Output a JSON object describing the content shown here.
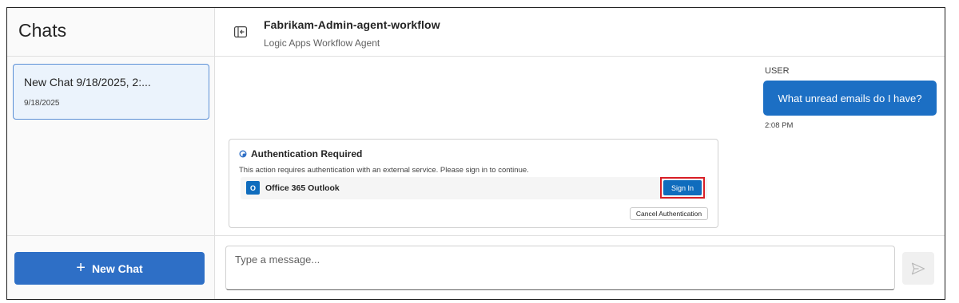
{
  "sidebar": {
    "title": "Chats",
    "chats": [
      {
        "title": "New Chat 9/18/2025, 2:...",
        "date": "9/18/2025"
      }
    ],
    "new_chat_label": "New Chat"
  },
  "header": {
    "title": "Fabrikam-Admin-agent-workflow",
    "subtitle": "Logic Apps Workflow Agent"
  },
  "conversation": {
    "user_label": "USER",
    "user_message": "What unread emails do I have?",
    "time": "2:08 PM",
    "auth_card": {
      "title": "Authentication Required",
      "description": "This action requires authentication with an external service. Please sign in to continue.",
      "service_name": "Office 365 Outlook",
      "sign_in_label": "Sign In",
      "cancel_label": "Cancel Authentication"
    }
  },
  "composer": {
    "placeholder": "Type a message..."
  },
  "colors": {
    "accent": "#1c6fc4",
    "highlight": "#d91f26",
    "selected_bg": "#ebf3fc"
  },
  "icons": {
    "collapse": "panel-collapse-icon",
    "auth": "auth-status-icon",
    "service": "outlook-icon",
    "send": "send-icon",
    "new_chat": "plus-icon"
  }
}
